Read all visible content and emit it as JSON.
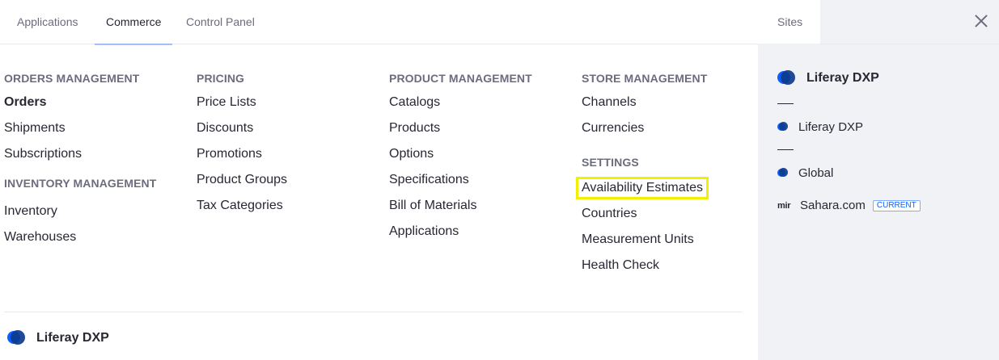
{
  "tabs": [
    {
      "label": "Applications"
    },
    {
      "label": "Commerce"
    },
    {
      "label": "Control Panel"
    }
  ],
  "columns": {
    "orders": {
      "heading": "ORDERS MANAGEMENT",
      "items": [
        "Orders",
        "Shipments",
        "Subscriptions"
      ]
    },
    "inventory": {
      "heading": "INVENTORY MANAGEMENT",
      "items": [
        "Inventory",
        "Warehouses"
      ]
    },
    "pricing": {
      "heading": "PRICING",
      "items": [
        "Price Lists",
        "Discounts",
        "Promotions",
        "Product Groups",
        "Tax Categories"
      ]
    },
    "product": {
      "heading": "PRODUCT MANAGEMENT",
      "items": [
        "Catalogs",
        "Products",
        "Options",
        "Specifications",
        "Bill of Materials",
        "Applications"
      ]
    },
    "store": {
      "heading": "STORE MANAGEMENT",
      "items": [
        "Channels",
        "Currencies"
      ]
    },
    "settings": {
      "heading": "SETTINGS",
      "items": [
        "Availability Estimates",
        "Countries",
        "Measurement Units",
        "Health Check"
      ]
    }
  },
  "footer": {
    "label": "Liferay DXP",
    "icon": "liferay-logo-icon"
  },
  "sidebar": {
    "tab_label": "Sites",
    "close_icon": "close-icon",
    "header_site": "Liferay DXP",
    "sites": [
      {
        "label": "Liferay DXP",
        "icon": "liferay-logo-icon"
      },
      {
        "label": "Global",
        "icon": "liferay-logo-icon"
      },
      {
        "label": "Sahara.com",
        "icon_text": "mir",
        "badge": "CURRENT"
      }
    ]
  },
  "colors": {
    "accent": "#0b5fff",
    "highlight": "#f0f000",
    "sidebar_bg": "#f1f2f5"
  }
}
